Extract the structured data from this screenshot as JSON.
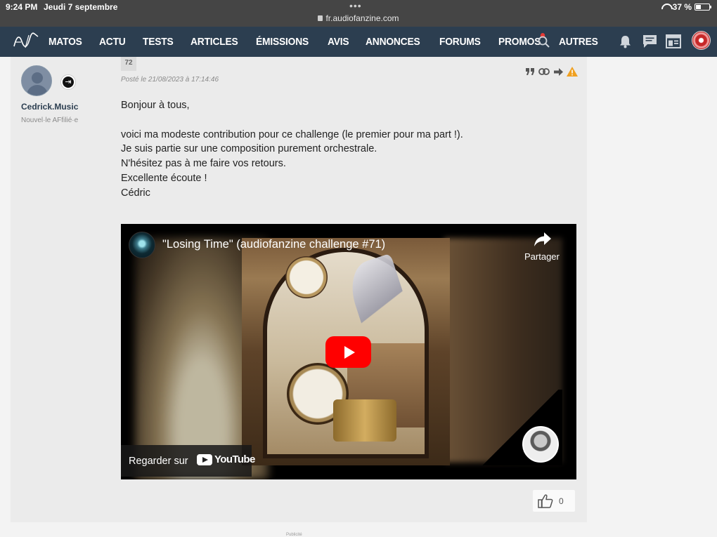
{
  "status_bar": {
    "time": "9:24 PM",
    "date": "Jeudi 7 septembre",
    "url": "fr.audiofanzine.com",
    "battery": "37 %",
    "battery_level": 0.37
  },
  "nav": {
    "items": [
      "MATOS",
      "ACTU",
      "TESTS",
      "ARTICLES",
      "ÉMISSIONS",
      "AVIS",
      "ANNONCES",
      "FORUMS",
      "PROMOS",
      "AUTRES"
    ],
    "promos_has_notification": true
  },
  "post": {
    "number": "72",
    "date": "Posté le 21/08/2023 à 17:14:46",
    "user": {
      "name": "Cedrick.Music",
      "role": "Nouvel·le AFfilié·e"
    },
    "body": [
      "Bonjour à tous,",
      "",
      "voici ma modeste contribution pour ce challenge (le premier pour ma part !).",
      "Je suis partie sur une composition purement orchestrale.",
      "N'hésitez pas à me faire vos retours.",
      "Excellente écoute !",
      "Cédric"
    ],
    "video": {
      "title": "\"Losing Time\" (audiofanzine challenge #71)",
      "share_label": "Partager",
      "watch_on_label": "Regarder sur",
      "platform": "YouTube"
    },
    "likes": "0"
  },
  "footer": {
    "ad_label": "Publicité"
  }
}
